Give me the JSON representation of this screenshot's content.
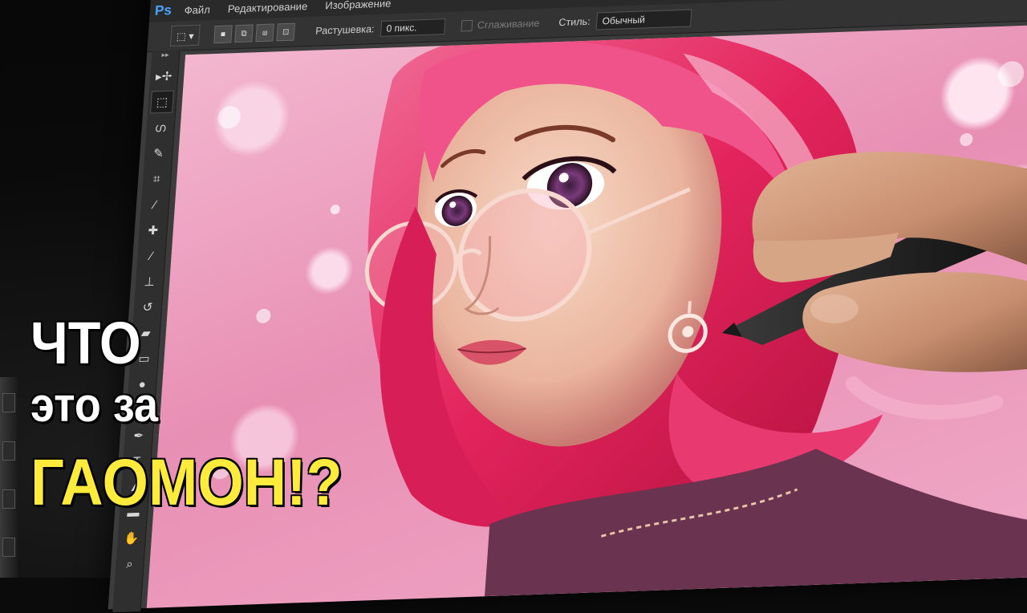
{
  "app": {
    "logo": "Ps",
    "menu": [
      "Файл",
      "Редактирование",
      "Изображение"
    ]
  },
  "options_bar": {
    "feather_label": "Растушевка:",
    "feather_value": "0 пикс.",
    "antialias_label": "Сглаживание",
    "style_label": "Стиль:",
    "style_value": "Обычный"
  },
  "tools": [
    {
      "name": "move-tool-icon",
      "glyph": "▸✢"
    },
    {
      "name": "marquee-tool-icon",
      "glyph": "⬚",
      "active": true
    },
    {
      "name": "lasso-tool-icon",
      "glyph": "ഗ"
    },
    {
      "name": "quick-select-tool-icon",
      "glyph": "✎"
    },
    {
      "name": "crop-tool-icon",
      "glyph": "⌗"
    },
    {
      "name": "eyedropper-tool-icon",
      "glyph": "⁄"
    },
    {
      "name": "healing-brush-tool-icon",
      "glyph": "✚"
    },
    {
      "name": "brush-tool-icon",
      "glyph": "∕"
    },
    {
      "name": "clone-stamp-tool-icon",
      "glyph": "⊥"
    },
    {
      "name": "history-brush-tool-icon",
      "glyph": "↺"
    },
    {
      "name": "eraser-tool-icon",
      "glyph": "▰"
    },
    {
      "name": "gradient-tool-icon",
      "glyph": "▭"
    },
    {
      "name": "blur-tool-icon",
      "glyph": "●"
    },
    {
      "name": "dodge-tool-icon",
      "glyph": "◐"
    },
    {
      "name": "pen-tool-icon",
      "glyph": "✒"
    },
    {
      "name": "type-tool-icon",
      "glyph": "T"
    },
    {
      "name": "path-select-tool-icon",
      "glyph": "▲"
    },
    {
      "name": "shape-tool-icon",
      "glyph": "▬"
    },
    {
      "name": "hand-tool-icon",
      "glyph": "✋"
    },
    {
      "name": "zoom-tool-icon",
      "glyph": "⌕"
    }
  ],
  "overlay": {
    "line1": "ЧТО",
    "line2": "это за",
    "line3": "ГАОМОН!?"
  },
  "colors": {
    "accent_yellow": "#ffeb3b",
    "hair_pink": "#e8245f",
    "ps_blue": "#4aa3ff"
  }
}
